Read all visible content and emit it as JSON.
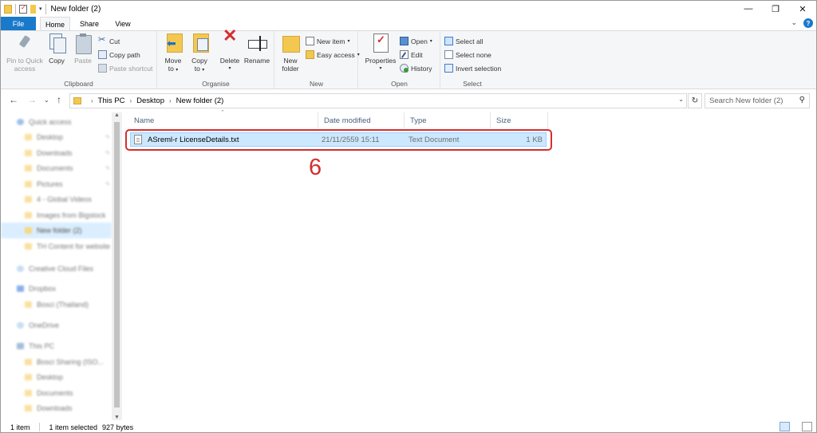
{
  "window": {
    "title": "New folder (2)"
  },
  "window_controls": {
    "minimize": "—",
    "maximize": "❐",
    "close": "✕"
  },
  "tabs": [
    {
      "label": "File"
    },
    {
      "label": "Home"
    },
    {
      "label": "Share"
    },
    {
      "label": "View"
    }
  ],
  "ribbon": {
    "clipboard": {
      "label": "Clipboard",
      "pin_line1": "Pin to Quick",
      "pin_line2": "access",
      "copy": "Copy",
      "paste": "Paste",
      "cut": "Cut",
      "copy_path": "Copy path",
      "paste_shortcut": "Paste shortcut"
    },
    "organise": {
      "label": "Organise",
      "move_line1": "Move",
      "move_line2": "to",
      "copy_line1": "Copy",
      "copy_line2": "to",
      "delete": "Delete",
      "rename": "Rename"
    },
    "new": {
      "label": "New",
      "new_folder_line1": "New",
      "new_folder_line2": "folder",
      "new_item": "New item",
      "easy_access": "Easy access"
    },
    "open": {
      "label": "Open",
      "properties": "Properties",
      "open": "Open",
      "edit": "Edit",
      "history": "History"
    },
    "select": {
      "label": "Select",
      "select_all": "Select all",
      "select_none": "Select none",
      "invert_selection": "Invert selection"
    }
  },
  "address": {
    "crumbs": [
      "This PC",
      "Desktop",
      "New folder (2)"
    ],
    "search_placeholder": "Search New folder (2)"
  },
  "nav_pane": {
    "items": [
      {
        "label": "Quick access",
        "icon": "star-icon"
      },
      {
        "label": "Desktop",
        "icon": "folder-icon"
      },
      {
        "label": "Downloads",
        "icon": "folder-icon"
      },
      {
        "label": "Documents",
        "icon": "folder-icon"
      },
      {
        "label": "Pictures",
        "icon": "folder-icon"
      },
      {
        "label": "4 - Global Videos",
        "icon": "folder-icon"
      },
      {
        "label": "Images from Bigstock",
        "icon": "folder-icon"
      },
      {
        "label": "New folder (2)",
        "icon": "folder-icon"
      },
      {
        "label": "TH Content for website",
        "icon": "folder-icon"
      },
      {
        "label": "Creative Cloud Files",
        "icon": "cloud-icon"
      },
      {
        "label": "Dropbox",
        "icon": "dropbox-icon"
      },
      {
        "label": "Bosci (Thailand)",
        "icon": "folder-icon"
      },
      {
        "label": "OneDrive",
        "icon": "cloud-icon"
      },
      {
        "label": "This PC",
        "icon": "pc-icon"
      },
      {
        "label": "Bosci Sharing (ISO...",
        "icon": "folder-icon"
      },
      {
        "label": "Desktop",
        "icon": "folder-icon"
      },
      {
        "label": "Documents",
        "icon": "folder-icon"
      },
      {
        "label": "Downloads",
        "icon": "folder-icon"
      }
    ]
  },
  "file_list": {
    "columns": [
      "Name",
      "Date modified",
      "Type",
      "Size"
    ],
    "rows": [
      {
        "name": "ASreml-r LicenseDetails.txt",
        "date": "21/11/2559 15:11",
        "type": "Text Document",
        "size": "1 KB"
      }
    ]
  },
  "annotation": {
    "step": "6",
    "color": "#d32f2f"
  },
  "status": {
    "count": "1 item",
    "selected": "1 item selected",
    "size": "927 bytes"
  },
  "colors": {
    "accent": "#1979ca",
    "selection": "#cce8ff"
  }
}
